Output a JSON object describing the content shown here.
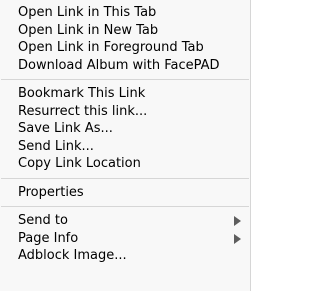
{
  "context_menu": {
    "group_1": [
      {
        "label": "Open Link in This Tab"
      },
      {
        "label": "Open Link in New Tab"
      },
      {
        "label": "Open Link in Foreground Tab"
      },
      {
        "label": "Download Album with FacePAD"
      }
    ],
    "group_2": [
      {
        "label": "Bookmark This Link"
      },
      {
        "label": "Resurrect this link..."
      },
      {
        "label": "Save Link As..."
      },
      {
        "label": "Send Link..."
      },
      {
        "label": "Copy Link Location"
      }
    ],
    "group_3": [
      {
        "label": "Properties"
      }
    ],
    "group_4": [
      {
        "label": "Send to",
        "submenu_icon": "chevron-right-icon"
      },
      {
        "label": "Page Info",
        "submenu_icon": "chevron-right-icon"
      },
      {
        "label": "Adblock Image..."
      }
    ]
  }
}
